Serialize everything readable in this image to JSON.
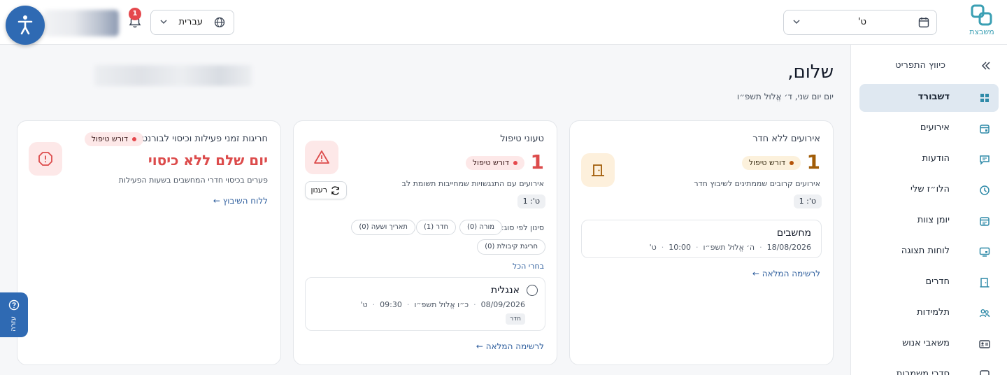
{
  "header": {
    "logo_text": "משבצת",
    "school_select_value": "ט'",
    "language_select_value": "עברית",
    "notifications_count": "1"
  },
  "sidebar": {
    "collapse_label": "כיווץ התפריט",
    "items": [
      {
        "label": "דשבורד",
        "icon": "dashboard-icon",
        "active": true
      },
      {
        "label": "אירועים",
        "icon": "calendar-event-icon"
      },
      {
        "label": "הודעות",
        "icon": "message-icon"
      },
      {
        "label": "הלו״ז שלי",
        "icon": "clock-icon"
      },
      {
        "label": "יומן צוות",
        "icon": "team-calendar-icon"
      },
      {
        "label": "לוחות תצוגה",
        "icon": "monitor-icon"
      },
      {
        "label": "חדרים",
        "icon": "door-icon"
      },
      {
        "label": "תלמידות",
        "icon": "students-icon"
      },
      {
        "label": "משאבי אנוש",
        "icon": "id-card-icon"
      },
      {
        "label": "סדרי משמרות",
        "icon": "shifts-icon"
      }
    ]
  },
  "greeting": {
    "hello": "שלום,",
    "date": "יום יום שני, ד׳ אֱלוּל תשפ״ו"
  },
  "cards": {
    "no_room": {
      "title": "אירועים ללא חדר",
      "count": "1",
      "badge": "דורש טיפול",
      "subtitle": "אירועים קרובים שממתינים לשיבוץ חדר",
      "class_tag": "ט': 1",
      "event": {
        "title": "מחשבים",
        "date": "18/08/2026",
        "hebrew_date": "ה׳ אֱלוּל תשפ״ו",
        "time": "10:00",
        "class": "ט'"
      },
      "link": "לרשימה המלאה ←"
    },
    "needs_handling": {
      "title": "טעוני טיפול",
      "count": "1",
      "badge": "דורש טיפול",
      "subtitle": "אירועים עם התנגשויות שמחייבות תשומת לב",
      "class_tag": "ט': 1",
      "refresh_label": "רענון",
      "filter_label": "סינון לפי סוג:",
      "filters": [
        "מורה (0)",
        "חדר (1)",
        "תאריך ושעה (0)",
        "חריגת קיבולת (0)"
      ],
      "select_all": "בחרי הכל",
      "event": {
        "title": "אנגלית",
        "date": "08/09/2026",
        "hebrew_date": "כ״ו אֱלוּל תשפ״ו",
        "time": "09:30",
        "class": "ט'",
        "tag": "חדר"
      },
      "link": "לרשימה המלאה ←"
    },
    "coverage": {
      "title": "חריגות זמני פעילות וכיסוי לבורנטיות",
      "badge": "דורש טיפול",
      "headline": "יום שלם ללא כיסוי",
      "subtitle": "פערים בכיסוי חדרי המחשבים בשעות הפעילות",
      "link": "ללוח השיבוץ ←"
    }
  },
  "help": {
    "label": "עזרה"
  },
  "colors": {
    "accent": "#2f6ab3",
    "warning_amber": "#b45309",
    "danger_red": "#e5484d",
    "link": "#2f5f9e"
  }
}
